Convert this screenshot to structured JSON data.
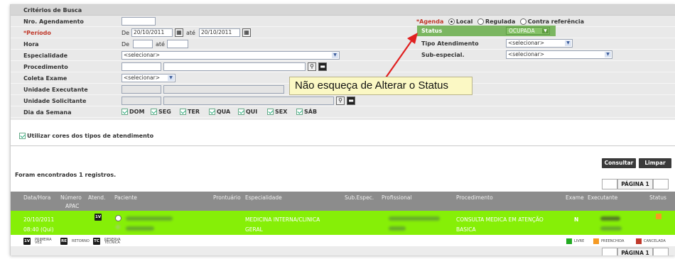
{
  "header": {
    "title": "Critérios de Busca"
  },
  "fields": {
    "nro_agendamento": "Nro. Agendamento",
    "periodo": "*Período",
    "periodo_de": "De",
    "periodo_de_value": "20/10/2011",
    "periodo_ate": "até",
    "periodo_ate_value": "20/10/2011",
    "hora": "Hora",
    "hora_de": "De",
    "hora_ate": "até",
    "especialidade": "Especialidade",
    "especialidade_value": "<selecionar>",
    "procedimento": "Procedimento",
    "coleta_exame": "Coleta Exame",
    "coleta_exame_value": "<selecionar>",
    "unidade_executante": "Unidade Executante",
    "unidade_solicitante": "Unidade Solicitante",
    "dia_semana": "Dia da Semana",
    "dias": [
      "DOM",
      "SEG",
      "TER",
      "QUA",
      "QUI",
      "SEX",
      "SÁB"
    ]
  },
  "right": {
    "agenda": "*Agenda",
    "agenda_options": [
      "Local",
      "Regulada",
      "Contra referência"
    ],
    "status_label": "Status",
    "status_value": "OCUPADA",
    "tipo_atendimento": "Tipo Atendimento",
    "tipo_value": "<selecionar>",
    "sub_especial": "Sub-especial.",
    "sub_value": "<selecionar>"
  },
  "callout": "Não esqueça de Alterar o Status",
  "utilizar_cores": "Utilizar cores dos tipos de atendimento",
  "buttons": {
    "consultar": "Consultar",
    "limpar": "Limpar"
  },
  "pagination": {
    "label": "PÁGINA 1"
  },
  "results_text": "Foram encontrados 1 registros.",
  "table": {
    "headers": {
      "data_hora": "Data/Hora",
      "numero": "Número",
      "apac": "APAC",
      "atend": "Atend.",
      "paciente": "Paciente",
      "prontuario": "Prontuário",
      "especialidade": "Especialidade",
      "sub_espec": "Sub.Espec.",
      "profissional": "Profissional",
      "procedimento": "Procedimento",
      "exame": "Exame",
      "executante": "Executante",
      "status": "Status"
    },
    "row": {
      "date": "20/10/2011",
      "time": "08:40 (Qui)",
      "atend_badge": "1V",
      "especialidade_1": "MEDICINA INTERNA/CLINICA",
      "especialidade_2": "GERAL",
      "procedimento_1": "CONSULTA MEDICA EM ATENÇÃO",
      "procedimento_2": "BASICA",
      "exame": "N"
    }
  },
  "legend": {
    "left": [
      {
        "badge": "1V",
        "text_1": "PRIMEIRA",
        "text_2": "VEZ"
      },
      {
        "badge": "RE",
        "text_1": "RETORNO",
        "text_2": ""
      },
      {
        "badge": "TC",
        "text_1": "RESERVA",
        "text_2": "TÉCNICA"
      }
    ],
    "right": [
      {
        "color": "#22aa22",
        "text": "LIVRE"
      },
      {
        "color": "#f59a23",
        "text": "PREENCHIDA"
      },
      {
        "color": "#c0392b",
        "text": "CANCELADA"
      }
    ]
  },
  "colors": {
    "status_green": "#7bb661",
    "row_green": "#86ef07",
    "arrow_red": "#e02020",
    "status_orange": "#f59a23"
  }
}
